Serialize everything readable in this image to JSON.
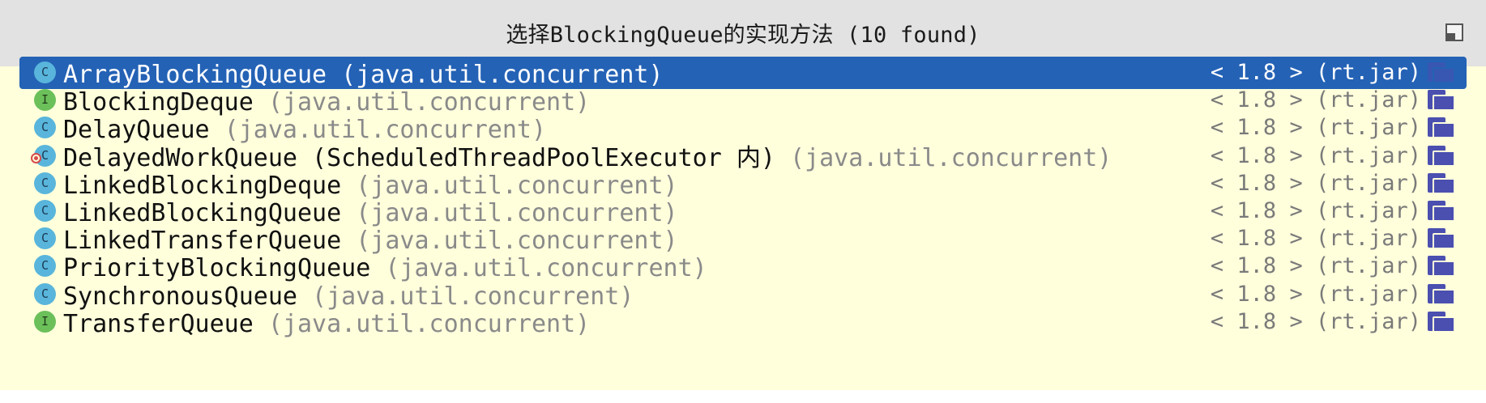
{
  "popup": {
    "title": "选择BlockingQueue的实现方法 (10 found)"
  },
  "colors": {
    "titlebar_bg": "#e2e2e2",
    "list_bg": "#ffffdc",
    "selection_bg": "#2462b5",
    "class_icon": "#59b5db",
    "interface_icon": "#6cc05a",
    "package_text": "#8a8a8a",
    "jar_icon": "#4a4fb0"
  },
  "icons": {
    "pin": "pin-window-icon",
    "class": "class-icon",
    "interface": "interface-icon",
    "inner_class": "inner-class-icon",
    "jar": "library-folder-icon"
  },
  "results": [
    {
      "kind": "C",
      "kind_label": "C",
      "name": "ArrayBlockingQueue",
      "package": "(java.util.concurrent)",
      "location": "< 1.8 > (rt.jar)",
      "selected": true
    },
    {
      "kind": "I",
      "kind_label": "I",
      "name": "BlockingDeque",
      "package": "(java.util.concurrent)",
      "location": "< 1.8 > (rt.jar)",
      "selected": false
    },
    {
      "kind": "C",
      "kind_label": "C",
      "name": "DelayQueue",
      "package": "(java.util.concurrent)",
      "location": "< 1.8 > (rt.jar)",
      "selected": false
    },
    {
      "kind": "C-inner",
      "kind_label": "C",
      "name": "DelayedWorkQueue (ScheduledThreadPoolExecutor 内)",
      "package": "(java.util.concurrent)",
      "location": "< 1.8 > (rt.jar)",
      "selected": false
    },
    {
      "kind": "C",
      "kind_label": "C",
      "name": "LinkedBlockingDeque",
      "package": "(java.util.concurrent)",
      "location": "< 1.8 > (rt.jar)",
      "selected": false
    },
    {
      "kind": "C",
      "kind_label": "C",
      "name": "LinkedBlockingQueue",
      "package": "(java.util.concurrent)",
      "location": "< 1.8 > (rt.jar)",
      "selected": false
    },
    {
      "kind": "C",
      "kind_label": "C",
      "name": "LinkedTransferQueue",
      "package": "(java.util.concurrent)",
      "location": "< 1.8 > (rt.jar)",
      "selected": false
    },
    {
      "kind": "C",
      "kind_label": "C",
      "name": "PriorityBlockingQueue",
      "package": "(java.util.concurrent)",
      "location": "< 1.8 > (rt.jar)",
      "selected": false
    },
    {
      "kind": "C",
      "kind_label": "C",
      "name": "SynchronousQueue",
      "package": "(java.util.concurrent)",
      "location": "< 1.8 > (rt.jar)",
      "selected": false
    },
    {
      "kind": "I",
      "kind_label": "I",
      "name": "TransferQueue",
      "package": "(java.util.concurrent)",
      "location": "< 1.8 > (rt.jar)",
      "selected": false
    }
  ]
}
